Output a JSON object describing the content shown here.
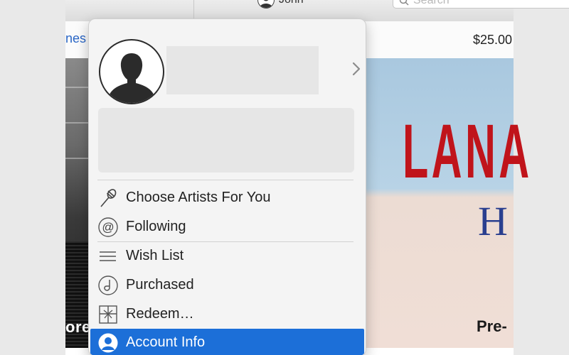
{
  "toolbar": {
    "user_name": "John",
    "search_placeholder": "Search"
  },
  "background": {
    "left_tab_label": "nes",
    "price": "$25.00",
    "concert_label": "ore",
    "album_artist_title": "LANA",
    "album_subtitle": "H",
    "album_cta": "Pre-"
  },
  "account_menu": {
    "items": [
      {
        "label": "Choose Artists For You",
        "icon": "microphone-icon"
      },
      {
        "label": "Following",
        "icon": "at-sign-icon"
      },
      {
        "label": "Wish List",
        "icon": "list-icon"
      },
      {
        "label": "Purchased",
        "icon": "purchased-icon"
      },
      {
        "label": "Redeem…",
        "icon": "gift-card-icon"
      },
      {
        "label": "Account Info",
        "icon": "user-icon",
        "selected": true
      }
    ]
  },
  "colors": {
    "selection_blue": "#1c6fd8",
    "album_red": "#c0141b",
    "album_blue": "#2a3f8f"
  }
}
